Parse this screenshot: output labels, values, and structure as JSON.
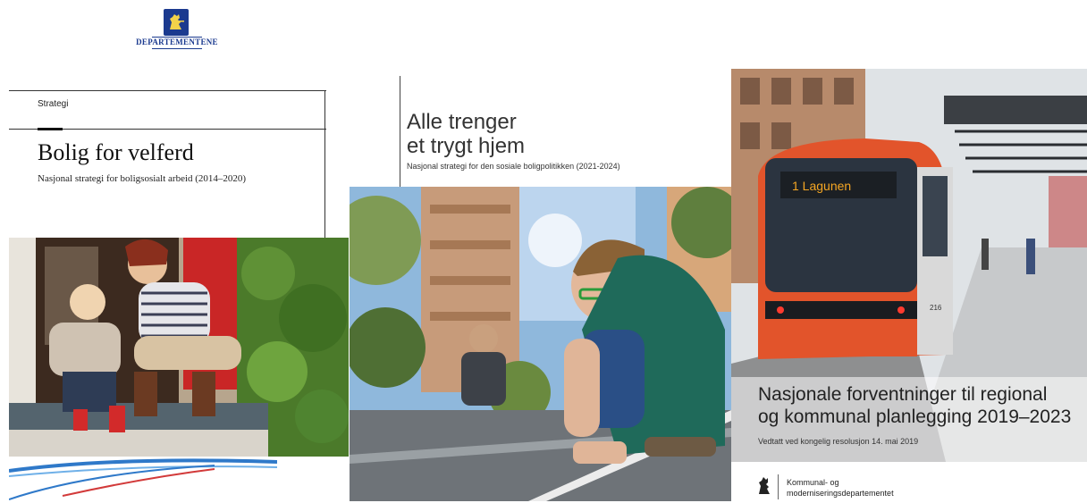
{
  "header": {
    "logo_text": "DEPARTEMENTENE"
  },
  "covers": [
    {
      "label": "Strategi",
      "title": "Bolig for velferd",
      "subtitle": "Nasjonal strategi for boligsosialt arbeid (2014–2020)"
    },
    {
      "title_line1": "Alle trenger",
      "title_line2": "et trygt hjem",
      "subtitle": "Nasjonal strategi for den sosiale boligpolitikken (2021-2024)"
    },
    {
      "tram_sign": "1  Lagunen",
      "tram_number": "216",
      "title_line1": "Nasjonale forventninger til regional",
      "title_line2": "og kommunal planlegging 2019–2023",
      "subtitle": "Vedtatt ved kongelig resolusjon 14. mai 2019",
      "dept_line1": "Kommunal- og",
      "dept_line2": "moderniseringsdepartementet"
    }
  ],
  "colors": {
    "crest_blue": "#1b3a8f",
    "tram_red": "#e2542b",
    "wave_blue": "#2f79c9",
    "wave_red": "#d23a3a"
  }
}
